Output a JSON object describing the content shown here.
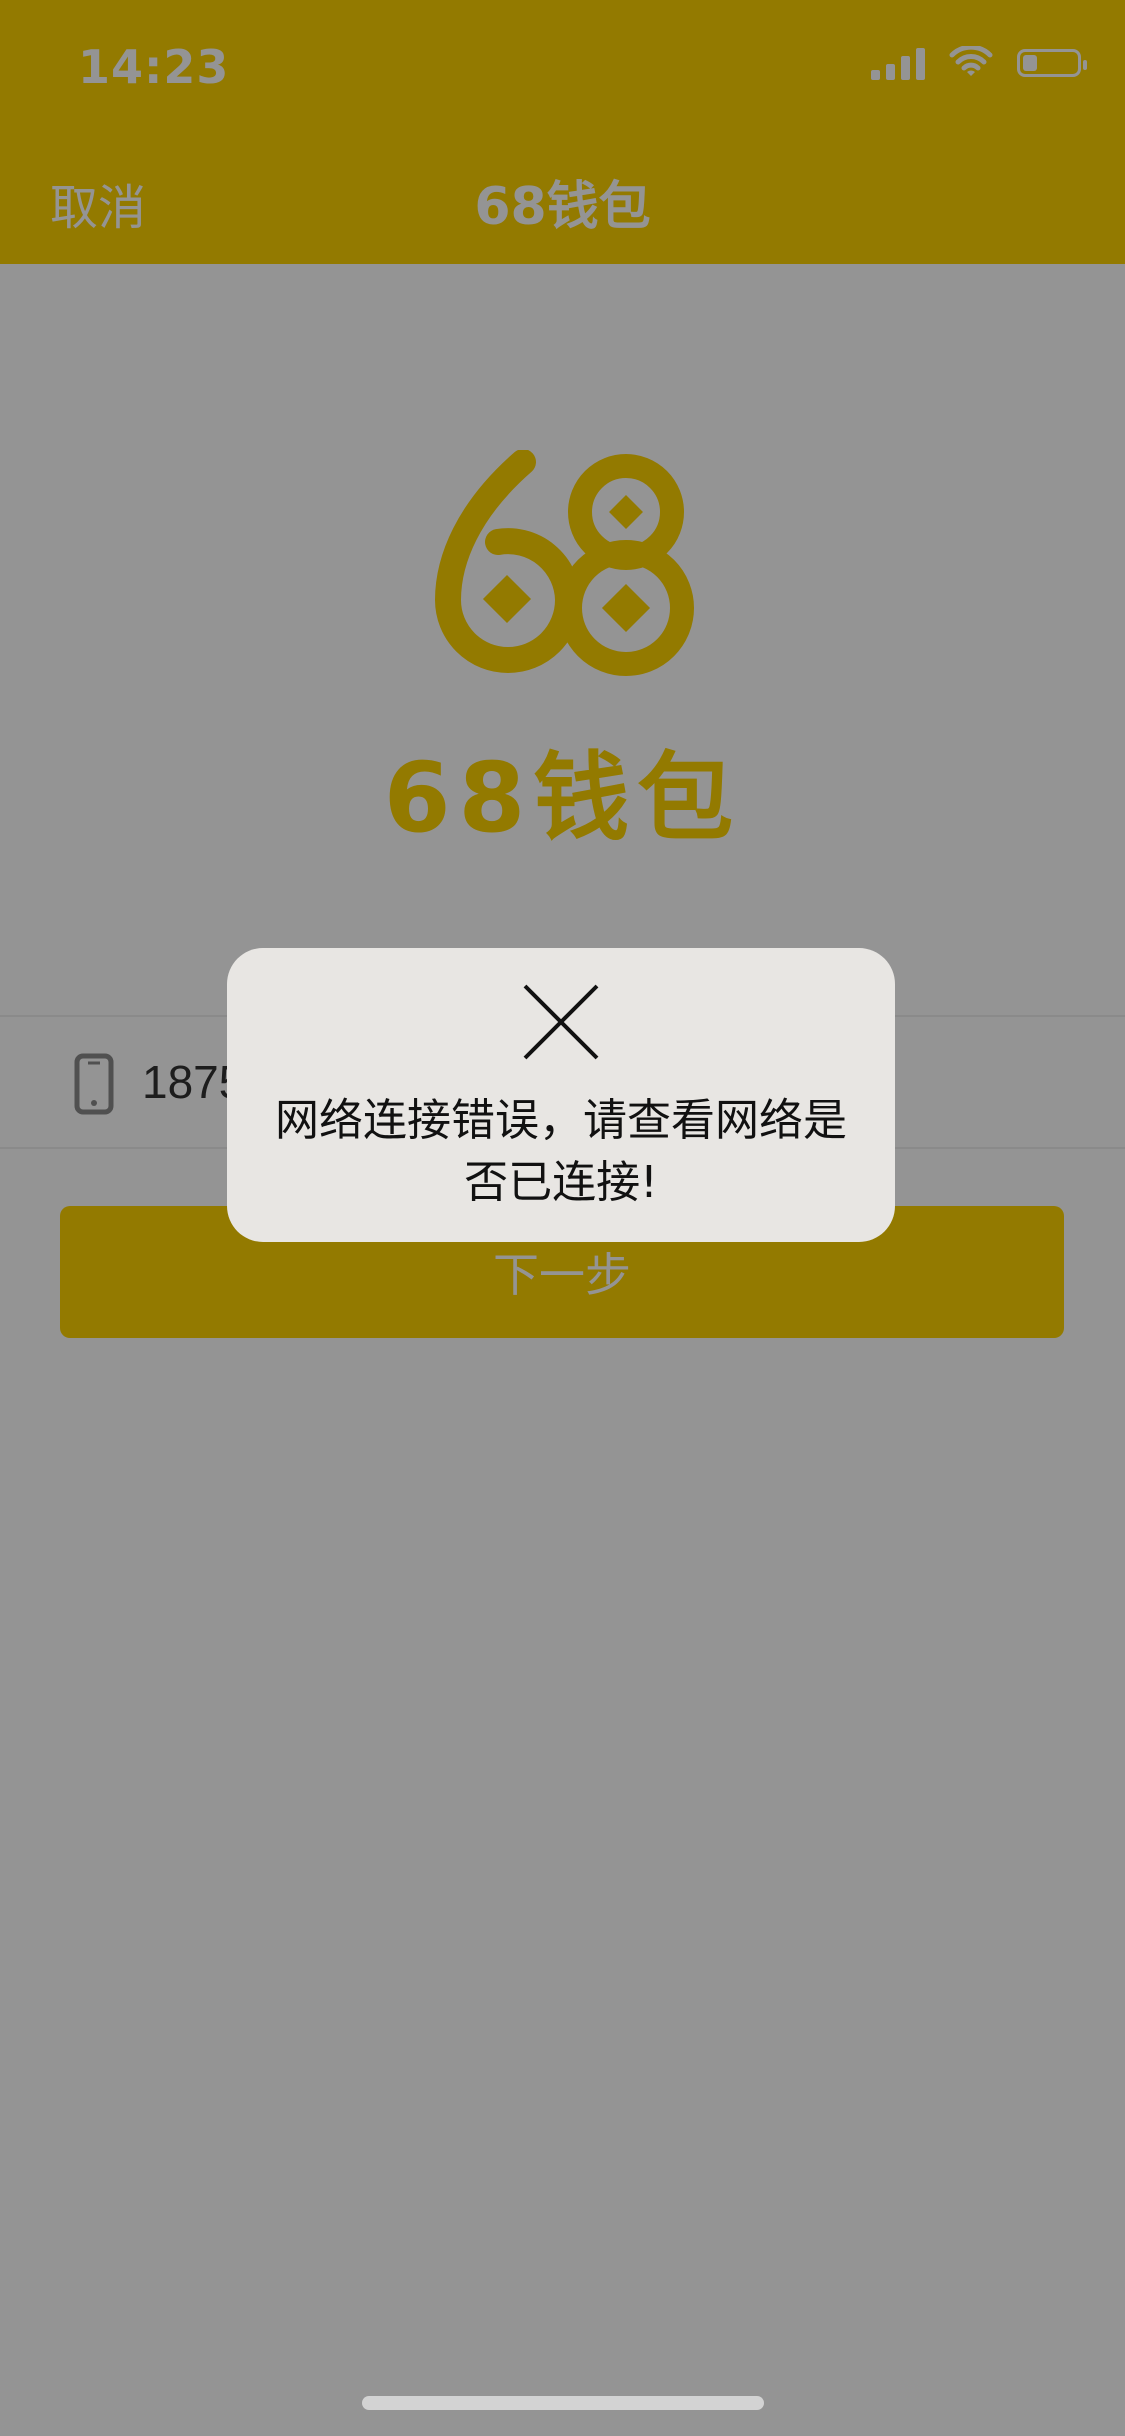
{
  "status_bar": {
    "time": "14:23",
    "signal_icon": "cellular-signal-icon",
    "wifi_icon": "wifi-icon",
    "battery_icon": "battery-icon"
  },
  "nav": {
    "cancel_label": "取消",
    "title": "68钱包"
  },
  "logo": {
    "mark_text": "68",
    "brand_text": "68钱包"
  },
  "form": {
    "phone_icon": "phone-icon",
    "phone_value": "1875"
  },
  "buttons": {
    "next_label": "下一步"
  },
  "toast": {
    "icon": "close-icon",
    "message": "网络连接错误，请查看网络是否已连接!"
  },
  "colors": {
    "brand_yellow": "#fdd200",
    "overlay": "rgba(0,0,0,0.42)",
    "toast_bg": "#e8e6e3"
  }
}
